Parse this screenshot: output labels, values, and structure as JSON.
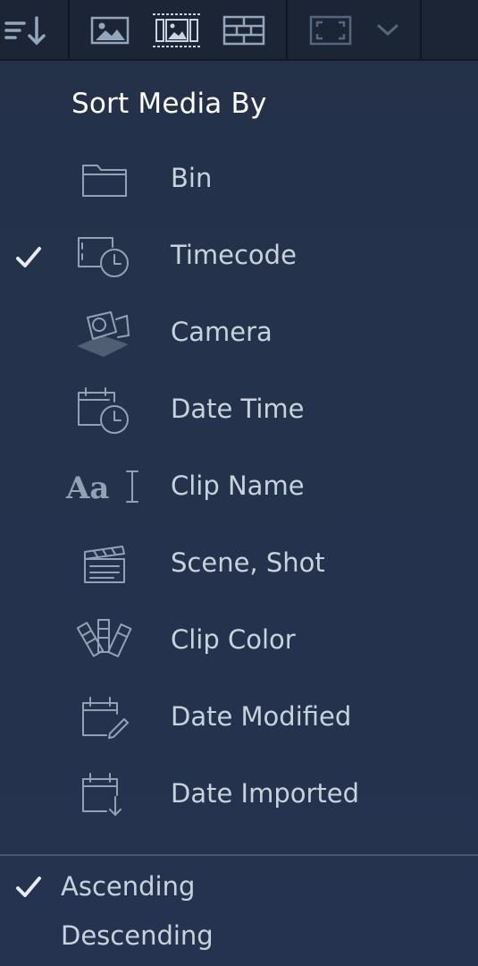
{
  "toolbar": {
    "buttons": [
      {
        "name": "sort-button",
        "icon": "sort-down-icon"
      },
      {
        "name": "thumbnail-view-button",
        "icon": "image-icon"
      },
      {
        "name": "filmstrip-view-button",
        "icon": "filmstrip-image-icon",
        "active": true
      },
      {
        "name": "list-view-button",
        "icon": "grid-list-icon"
      },
      {
        "name": "fullscreen-button",
        "icon": "fullscreen-icon"
      },
      {
        "name": "more-dropdown-button",
        "icon": "chevron-down-icon"
      }
    ]
  },
  "menu": {
    "title": "Sort Media By",
    "items": [
      {
        "label": "Bin",
        "icon": "folder-icon",
        "checked": false
      },
      {
        "label": "Timecode",
        "icon": "timecode-icon",
        "checked": true
      },
      {
        "label": "Camera",
        "icon": "camera-icon",
        "checked": false
      },
      {
        "label": "Date Time",
        "icon": "calendar-clock-icon",
        "checked": false
      },
      {
        "label": "Clip Name",
        "icon": "text-cursor-icon",
        "checked": false
      },
      {
        "label": "Scene, Shot",
        "icon": "clapperboard-icon",
        "checked": false
      },
      {
        "label": "Clip Color",
        "icon": "color-swatch-icon",
        "checked": false
      },
      {
        "label": "Date Modified",
        "icon": "calendar-edit-icon",
        "checked": false
      },
      {
        "label": "Date Imported",
        "icon": "calendar-import-icon",
        "checked": false
      }
    ],
    "order": [
      {
        "label": "Ascending",
        "checked": true
      },
      {
        "label": "Descending",
        "checked": false
      }
    ]
  },
  "colors": {
    "background": "#243149",
    "toolbar": "#1c2536",
    "text": "#c8d2dc",
    "title": "#ffffff",
    "icon": "#93a2b2"
  }
}
